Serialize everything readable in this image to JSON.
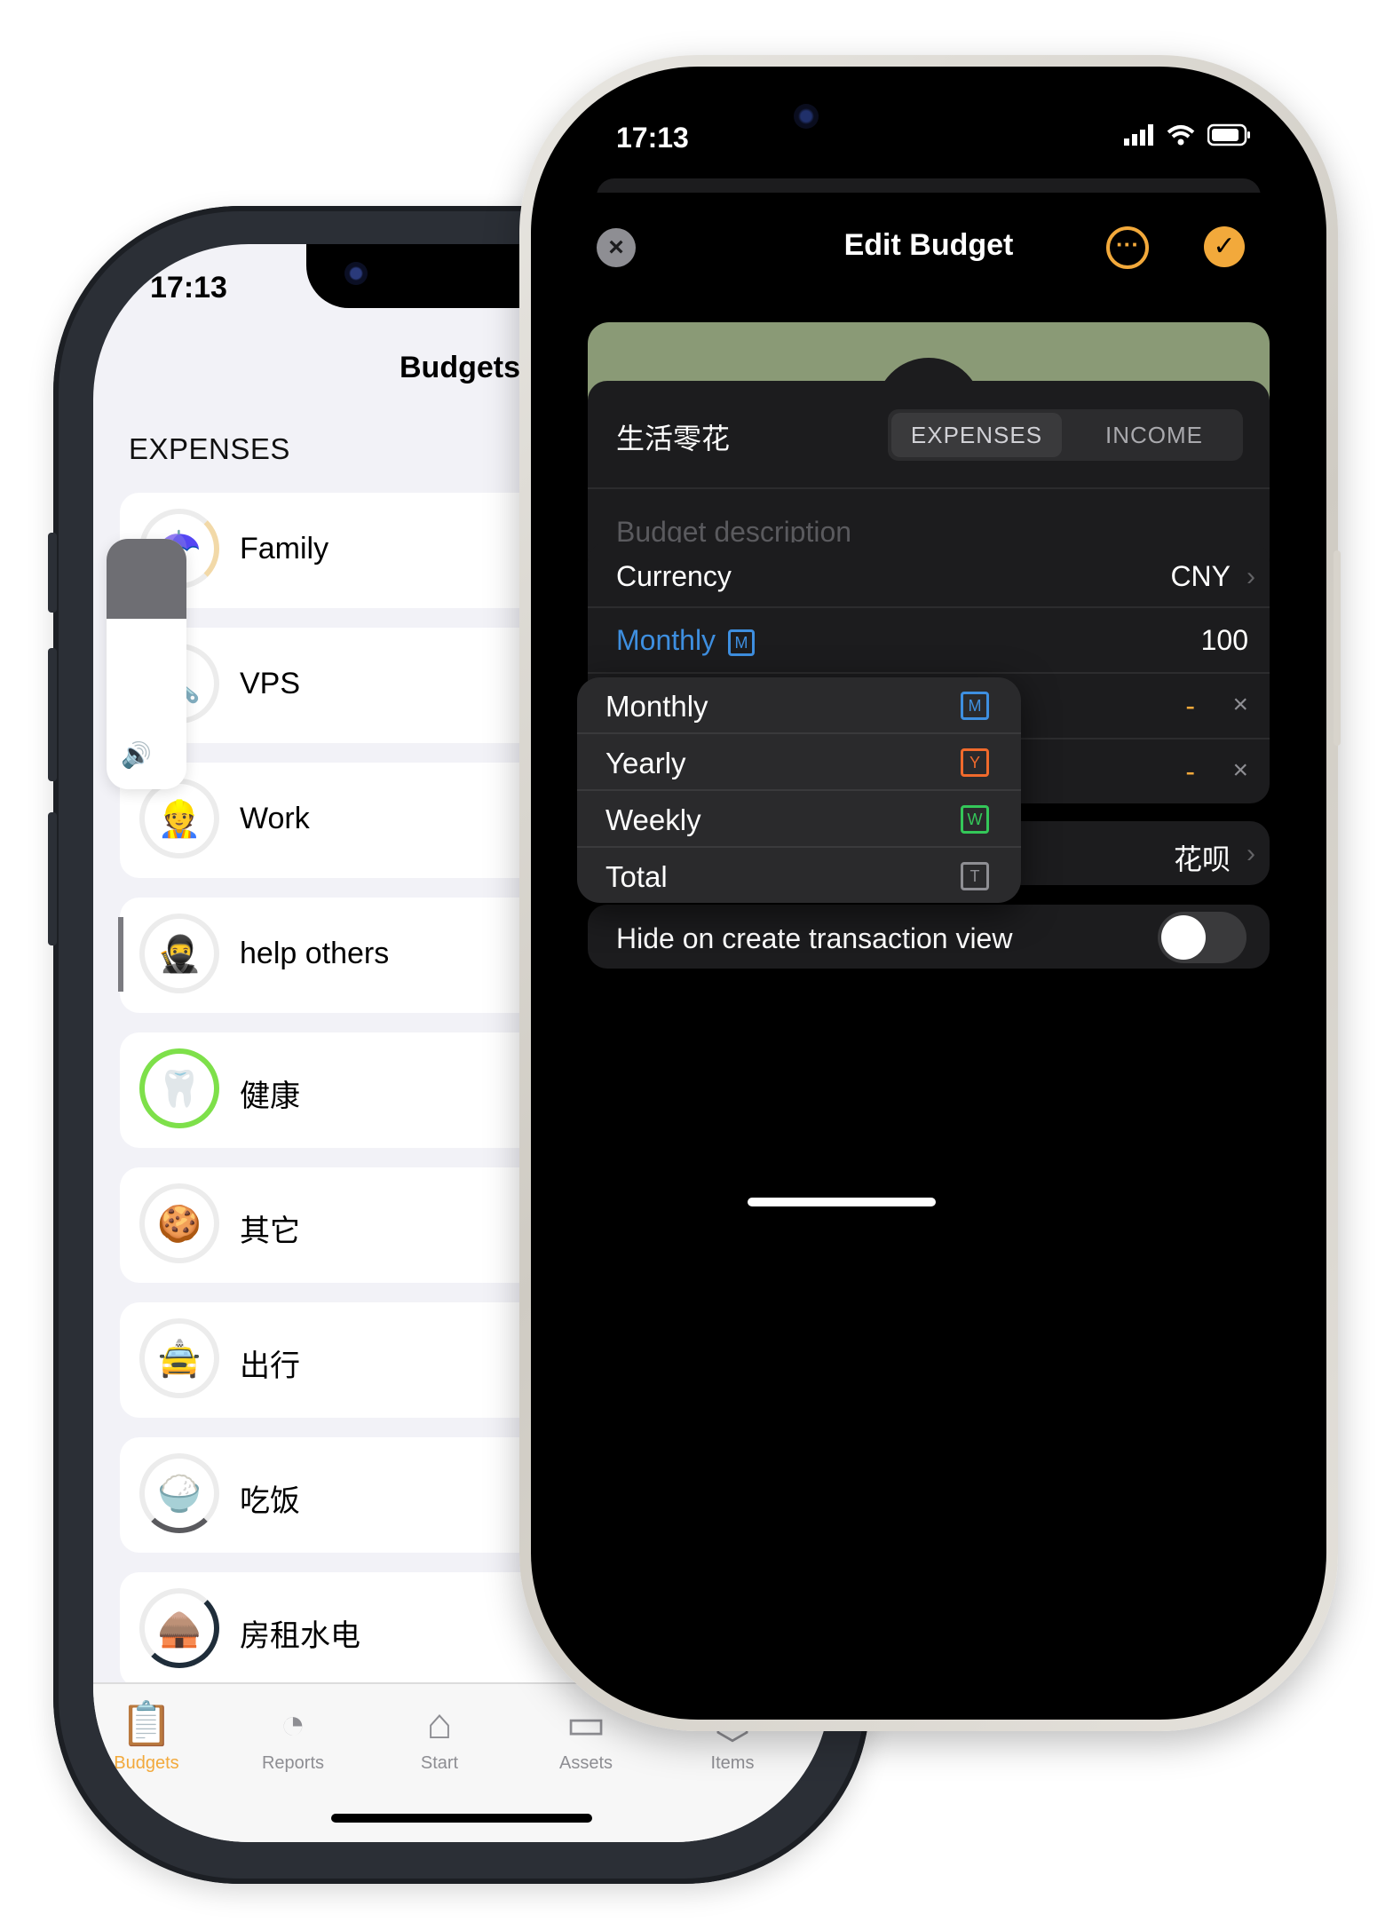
{
  "colors": {
    "accent": "#f2a93b",
    "link_blue": "#3e8fe0",
    "banner": "#8a9a76",
    "monthly_key": "#3e8fe0",
    "yearly_key": "#f06a2c",
    "weekly_key": "#34c759",
    "total_key": "#8e8e93"
  },
  "back_phone": {
    "time": "17:13",
    "title": "Budgets",
    "section": "EXPENSES",
    "items": [
      {
        "label": "Family",
        "icon": "☂️"
      },
      {
        "label": "VPS",
        "icon": "🔧"
      },
      {
        "label": "Work",
        "icon": "👷"
      },
      {
        "label": "help others",
        "icon": "🥷"
      },
      {
        "label": "健康",
        "icon": "🦷"
      },
      {
        "label": "其它",
        "icon": "🍪"
      },
      {
        "label": "出行",
        "icon": "🚖"
      },
      {
        "label": "吃饭",
        "icon": "🍚"
      },
      {
        "label": "房租水电",
        "icon": "🛖"
      }
    ],
    "tabs": [
      {
        "label": "Budgets",
        "icon": "📋"
      },
      {
        "label": "Reports",
        "icon": "◔"
      },
      {
        "label": "Start",
        "icon": "⌂"
      },
      {
        "label": "Assets",
        "icon": "▭"
      },
      {
        "label": "Items",
        "icon": "⬡"
      }
    ]
  },
  "front_phone": {
    "time": "17:13",
    "title": "Edit Budget",
    "avatar_icon": "☂️",
    "name": "生活零花",
    "type_segments": [
      "EXPENSES",
      "INCOME"
    ],
    "description_placeholder": "Budget description",
    "currency_label": "Currency",
    "currency_value": "CNY",
    "period_label": "Monthly",
    "period_key": "M",
    "amount": "100",
    "dash": "-",
    "account_value": "花呗",
    "hide_label": "Hide on create transaction view",
    "hide_on": false,
    "period_menu": [
      {
        "label": "Monthly",
        "key": "M"
      },
      {
        "label": "Yearly",
        "key": "Y"
      },
      {
        "label": "Weekly",
        "key": "W"
      },
      {
        "label": "Total",
        "key": "T"
      }
    ]
  }
}
